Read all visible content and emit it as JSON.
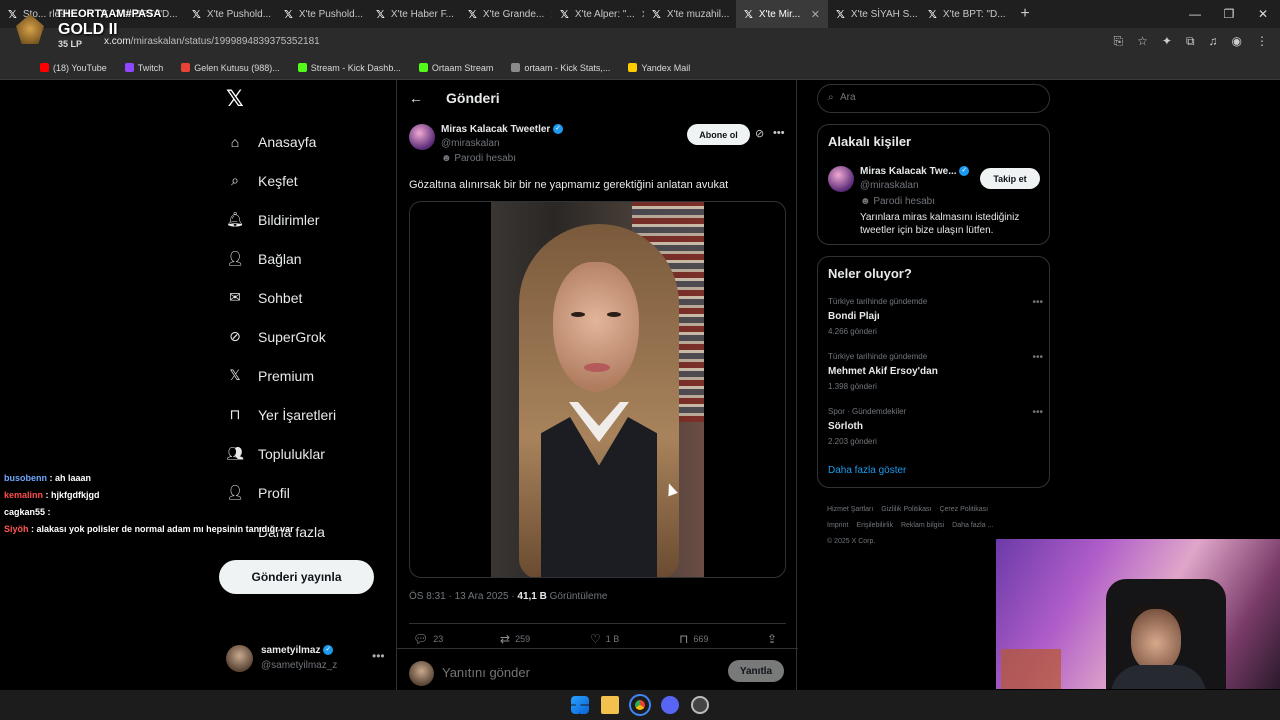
{
  "browser": {
    "tabs": [
      {
        "title": "Sto... rlesler Onu",
        "active": false
      },
      {
        "title": "X'te BPT: \"D...",
        "active": false
      },
      {
        "title": "X'te Pushold...",
        "active": false
      },
      {
        "title": "X'te Pushold...",
        "active": false
      },
      {
        "title": "X'te Haber F...",
        "active": false
      },
      {
        "title": "X'te Grande...",
        "active": false
      },
      {
        "title": "X'te Alper: \"...",
        "active": false
      },
      {
        "title": "X'te muzahil...",
        "active": false
      },
      {
        "title": "X'te Mir...",
        "active": true
      },
      {
        "title": "X'te SİYAH S...",
        "active": false
      },
      {
        "title": "X'te BPT: \"D...",
        "active": false
      }
    ],
    "url_host": "x.com",
    "url_path": "/miraskalan/status/1999894839375352181",
    "bookmarks": [
      {
        "label": "(18) YouTube",
        "color": "#ff0000"
      },
      {
        "label": "Twitch",
        "color": "#9146ff"
      },
      {
        "label": "Gelen Kutusu (988)...",
        "color": "#ea4335"
      },
      {
        "label": "Stream - Kick Dashb...",
        "color": "#53fc18"
      },
      {
        "label": "Ortaam Stream",
        "color": "#53fc18"
      },
      {
        "label": "ortaam - Kick Stats,...",
        "color": "#8a8a8a"
      },
      {
        "label": "Yandex Mail",
        "color": "#ffcc00"
      }
    ]
  },
  "overlay": {
    "player_name": "THEORTAAM#PASA",
    "rank": "GOLD II",
    "lp": "35 LP"
  },
  "nav": {
    "items": [
      {
        "label": "Anasayfa",
        "icon": "home-icon"
      },
      {
        "label": "Keşfet",
        "icon": "search-icon"
      },
      {
        "label": "Bildirimler",
        "icon": "bell-icon"
      },
      {
        "label": "Bağlan",
        "icon": "person-add-icon"
      },
      {
        "label": "Sohbet",
        "icon": "mail-icon"
      },
      {
        "label": "SuperGrok",
        "icon": "grok-icon"
      },
      {
        "label": "Premium",
        "icon": "x-premium-icon"
      },
      {
        "label": "Yer İşaretleri",
        "icon": "bookmark-icon"
      },
      {
        "label": "Topluluklar",
        "icon": "communities-icon"
      },
      {
        "label": "Profil",
        "icon": "profile-icon"
      },
      {
        "label": "Daha fazla",
        "icon": "more-circle-icon"
      }
    ],
    "post_button": "Gönderi yayınla",
    "account": {
      "name": "sametyilmaz",
      "handle": "@sametyilmaz_z"
    }
  },
  "post": {
    "header_title": "Gönderi",
    "author_name": "Miras Kalacak Tweetler",
    "author_handle": "@miraskalan",
    "parody_label": "Parodi hesabı",
    "follow_label": "Abone ol",
    "text": "Gözaltına alınırsak bir bir ne yapmamız gerektiğini anlatan avukat",
    "time": "ÖS 8:31 · 13 Ara 2025 · ",
    "views_count": "41,1 B",
    "views_label": " Görüntüleme",
    "replies": "23",
    "reposts": "259",
    "likes": "1 B",
    "bookmarks": "669",
    "reply_placeholder": "Yanıtını gönder",
    "reply_button": "Yanıtla"
  },
  "right": {
    "search_placeholder": "Ara",
    "related_title": "Alakalı kişiler",
    "related": {
      "name": "Miras Kalacak Twe...",
      "handle": "@miraskalan",
      "parody": "Parodi hesabı",
      "bio": "Yarınlara miras kalmasını istediğiniz tweetler için bize ulaşın lütfen.",
      "follow": "Takip et"
    },
    "trends_title": "Neler oluyor?",
    "trends": [
      {
        "context": "Türkiye tarihinde gündemde",
        "title": "Bondi Plajı",
        "count": "4.266 gönderi"
      },
      {
        "context": "Türkiye tarihinde gündemde",
        "title": "Mehmet Akif Ersoy'dan",
        "count": "1.398 gönderi"
      },
      {
        "context": "Spor · Gündemdekiler",
        "title": "Sörloth",
        "count": "2.203 gönderi"
      }
    ],
    "show_more": "Daha fazla göster",
    "footer": [
      "Hizmet Şartları",
      "Gizlilik Politikası",
      "Çerez Politikası",
      "Imprint",
      "Erişilebilirlik",
      "Reklam bilgisi",
      "Daha fazla ...",
      "© 2025 X Corp."
    ]
  },
  "chat": [
    {
      "user": "busobenn",
      "text": " : ah laaan"
    },
    {
      "user": "kemalinn",
      "text": " : hjkfgdfkjgd"
    },
    {
      "user": "cagkan55",
      "text": " : "
    },
    {
      "user": "Siyöh",
      "text": " : alakası yok polisler de normal adam mı hepsinin tanıdığı var"
    }
  ]
}
